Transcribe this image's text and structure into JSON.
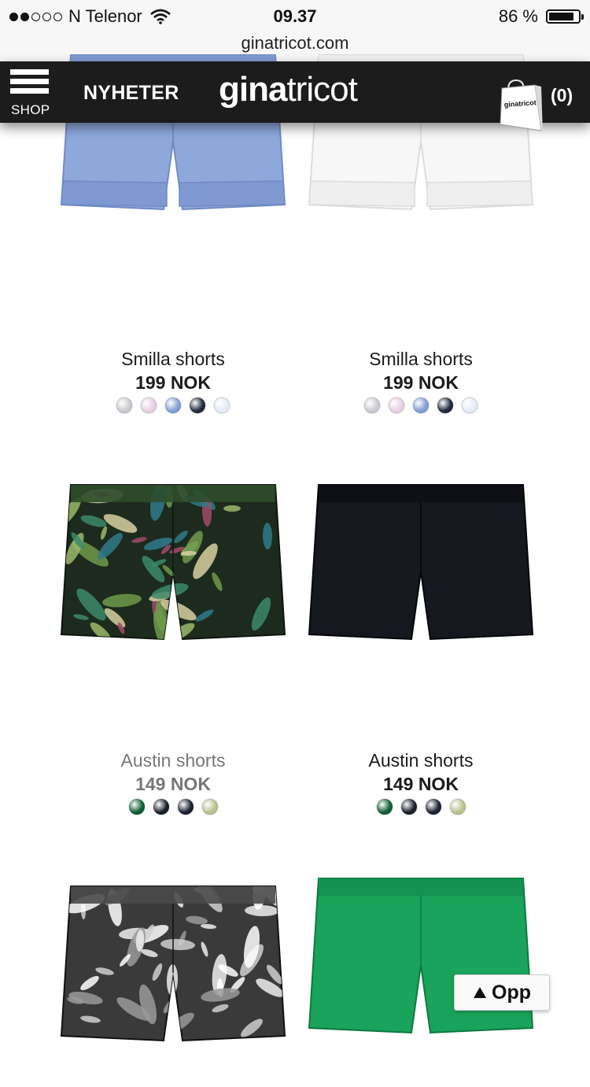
{
  "status_bar": {
    "carrier": "N Telenor",
    "time": "09.37",
    "battery": "86 %",
    "battery_level": 0.86,
    "signal_bars": 2
  },
  "url": "ginatricot.com",
  "header": {
    "menu_label": "SHOP",
    "nav_news": "NYHETER",
    "logo_bold": "gina",
    "logo_light": "tricot",
    "bag_logo": "ginatricot",
    "cart_count": "(0)"
  },
  "products": [
    {
      "name": "Smilla shorts",
      "price": "199 NOK",
      "image": "light-blue-shorts",
      "swatches": [
        "#c9ccd0",
        "#e8cfe0",
        "#7f9fd6",
        "#1f2a3c",
        "#e6ecf8"
      ],
      "muted": false
    },
    {
      "name": "Smilla shorts",
      "price": "199 NOK",
      "image": "white-shorts",
      "swatches": [
        "#c9ccd0",
        "#e8cfe0",
        "#7f9fd6",
        "#1f2a3c",
        "#e6ecf8"
      ],
      "muted": false
    },
    {
      "name": "Austin shorts",
      "price": "149 NOK",
      "image": "tropical-print-shorts",
      "swatches": [
        "#0f5e33",
        "#1a1f2a",
        "#1c2231",
        "#b8c48e"
      ],
      "muted": true
    },
    {
      "name": "Austin shorts",
      "price": "149 NOK",
      "image": "black-shorts",
      "swatches": [
        "#0f5e33",
        "#1a1f2a",
        "#1c2231",
        "#b8c48e"
      ],
      "muted": false
    },
    {
      "name": "",
      "price": "",
      "image": "black-white-leaf-shorts",
      "swatches": [],
      "muted": false
    },
    {
      "name": "",
      "price": "",
      "image": "green-shorts",
      "swatches": [],
      "muted": false
    }
  ],
  "back_to_top": {
    "label": "Opp"
  }
}
